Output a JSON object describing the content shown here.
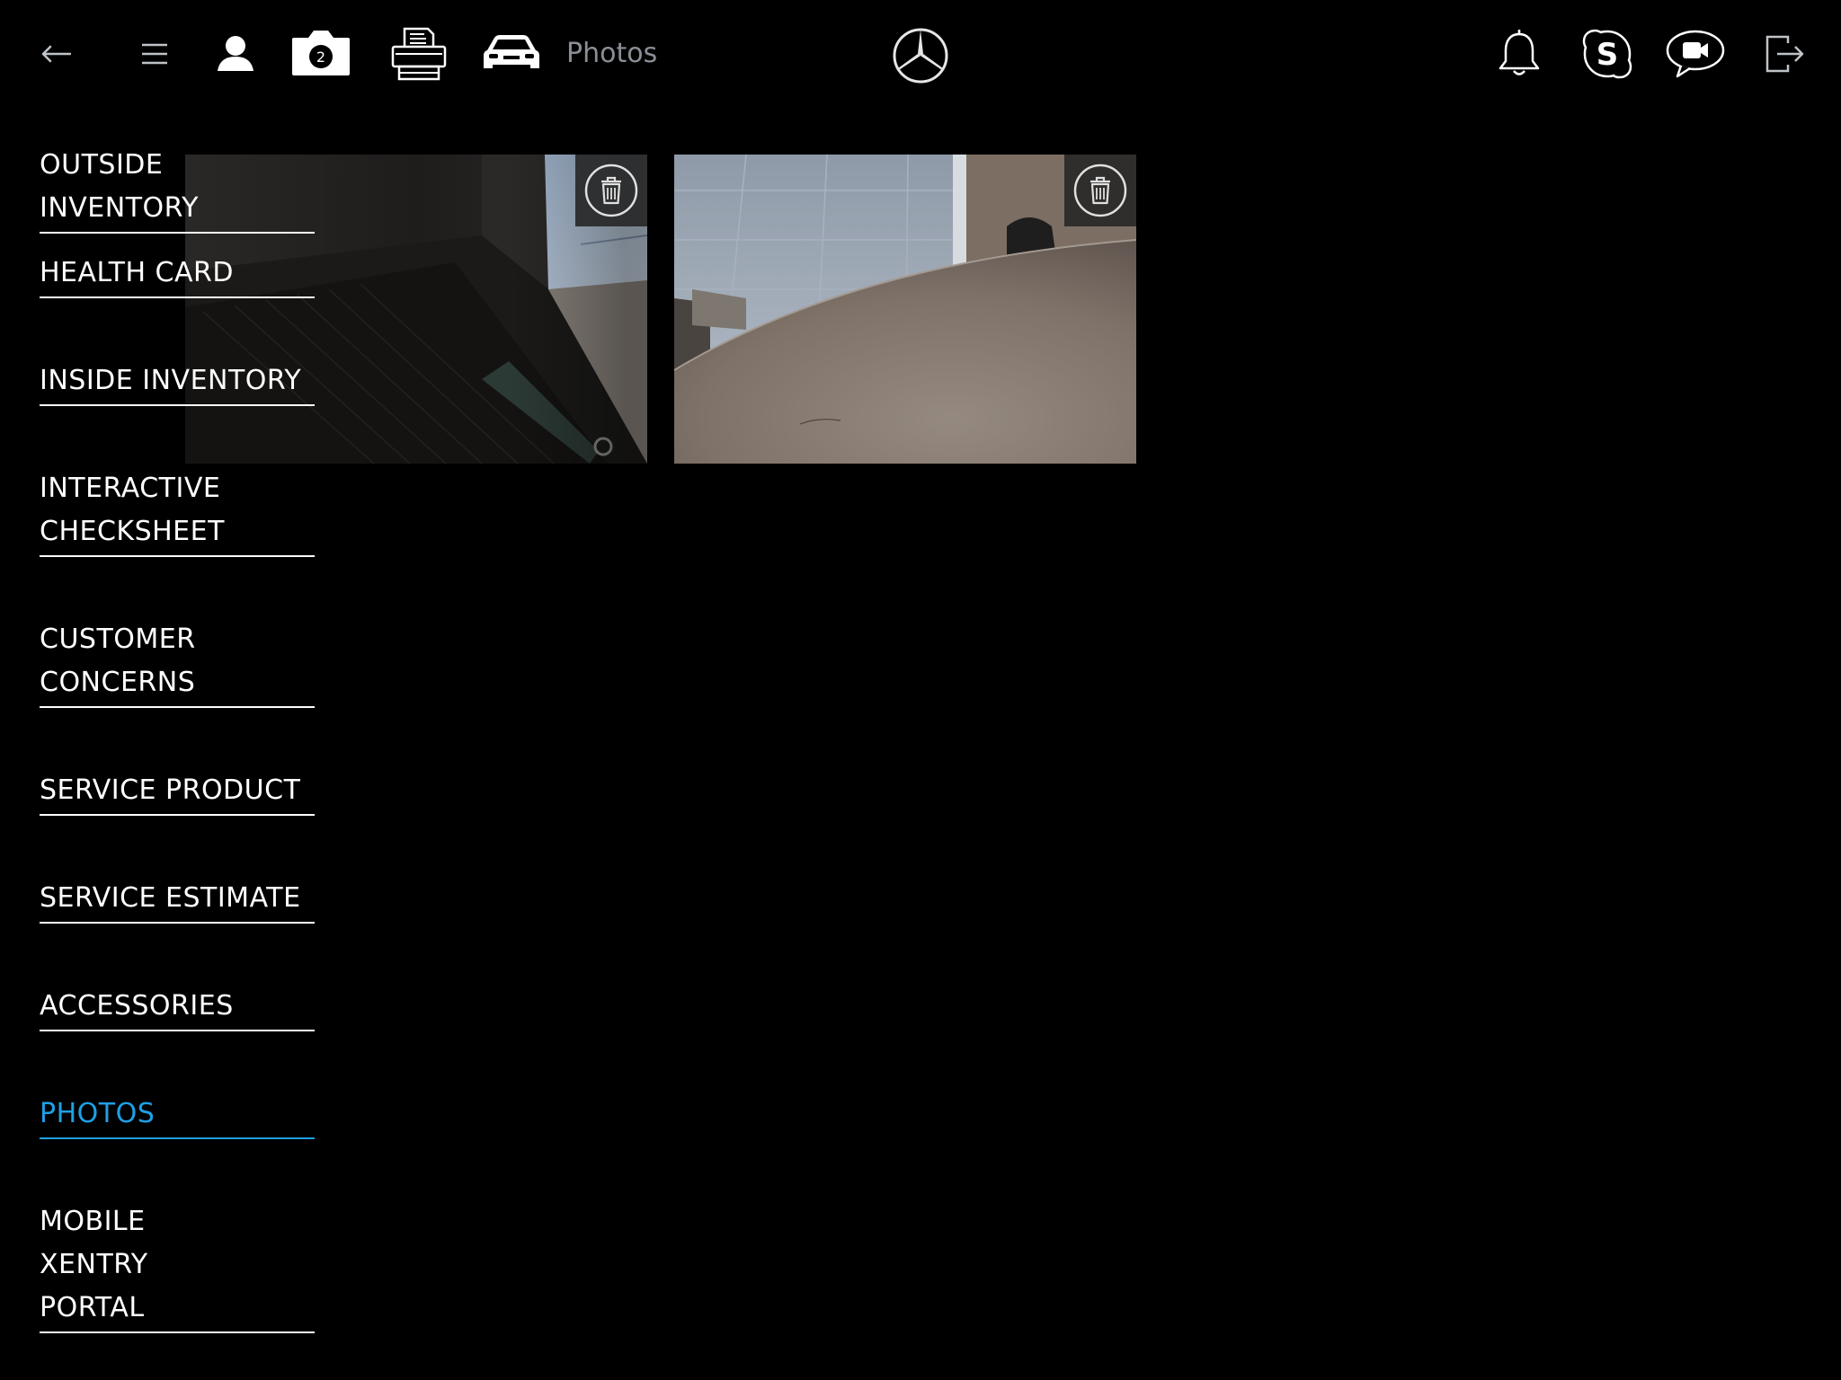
{
  "header": {
    "title": "Photos",
    "camera_badge": "2",
    "icons": [
      "back-arrow-icon",
      "hamburger-menu-icon",
      "person-icon",
      "camera-icon",
      "printer-icon",
      "car-icon",
      "mercedes-star-logo",
      "bell-icon",
      "skype-icon",
      "video-chat-icon",
      "logout-icon"
    ]
  },
  "sidebar": {
    "items": [
      {
        "label": "OUTSIDE INVENTORY",
        "active": false
      },
      {
        "label": "HEALTH CARD",
        "active": false
      },
      {
        "label": "INSIDE INVENTORY",
        "active": false
      },
      {
        "label": "INTERACTIVE CHECKSHEET",
        "active": false
      },
      {
        "label": "CUSTOMER CONCERNS",
        "active": false
      },
      {
        "label": "SERVICE PRODUCT",
        "active": false
      },
      {
        "label": "SERVICE ESTIMATE",
        "active": false
      },
      {
        "label": "ACCESSORIES",
        "active": false
      },
      {
        "label": "PHOTOS",
        "active": true
      },
      {
        "label": "MOBILE XENTRY PORTAL",
        "active": false
      }
    ]
  },
  "photos": {
    "count": 2,
    "delete_icon": "trash-icon"
  },
  "colors": {
    "background": "#000000",
    "text": "#ffffff",
    "active": "#1ea0e6",
    "title_gray": "#8a8f96"
  }
}
